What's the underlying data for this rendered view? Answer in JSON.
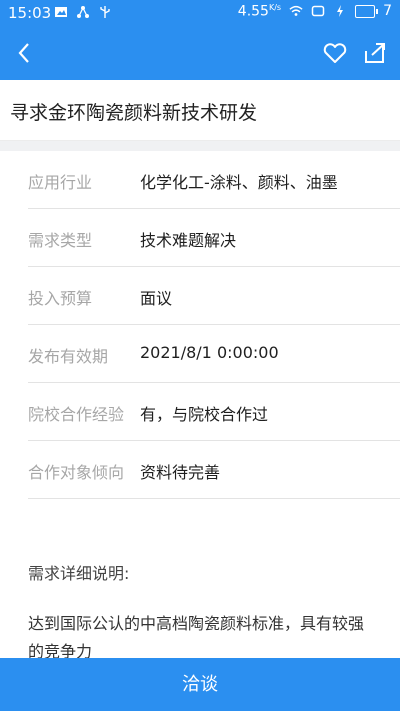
{
  "status_bar": {
    "time": "15:03",
    "speed": "4.55",
    "speed_unit": "K/s",
    "battery_level": "7"
  },
  "header": {
    "back_icon": "chevron-left-icon",
    "favorite_icon": "heart-icon",
    "share_icon": "share-icon"
  },
  "title": "寻求金环陶瓷颜料新技术研发",
  "details": [
    {
      "label": "应用行业",
      "value": "化学化工-涂料、颜料、油墨"
    },
    {
      "label": "需求类型",
      "value": "技术难题解决"
    },
    {
      "label": "投入预算",
      "value": "面议"
    },
    {
      "label": "发布有效期",
      "value": "2021/8/1 0:00:00"
    },
    {
      "label": "院校合作经验",
      "value": "有，与院校合作过"
    },
    {
      "label": "合作对象倾向",
      "value": "资料待完善"
    }
  ],
  "description": {
    "heading": "需求详细说明:",
    "text": "达到国际公认的中高档陶瓷颜料标准，具有较强的竞争力"
  },
  "action_button": "洽谈",
  "colors": {
    "primary": "#2b8ff0",
    "label_gray": "#a7a7a7",
    "separator": "#f0f1f3"
  }
}
